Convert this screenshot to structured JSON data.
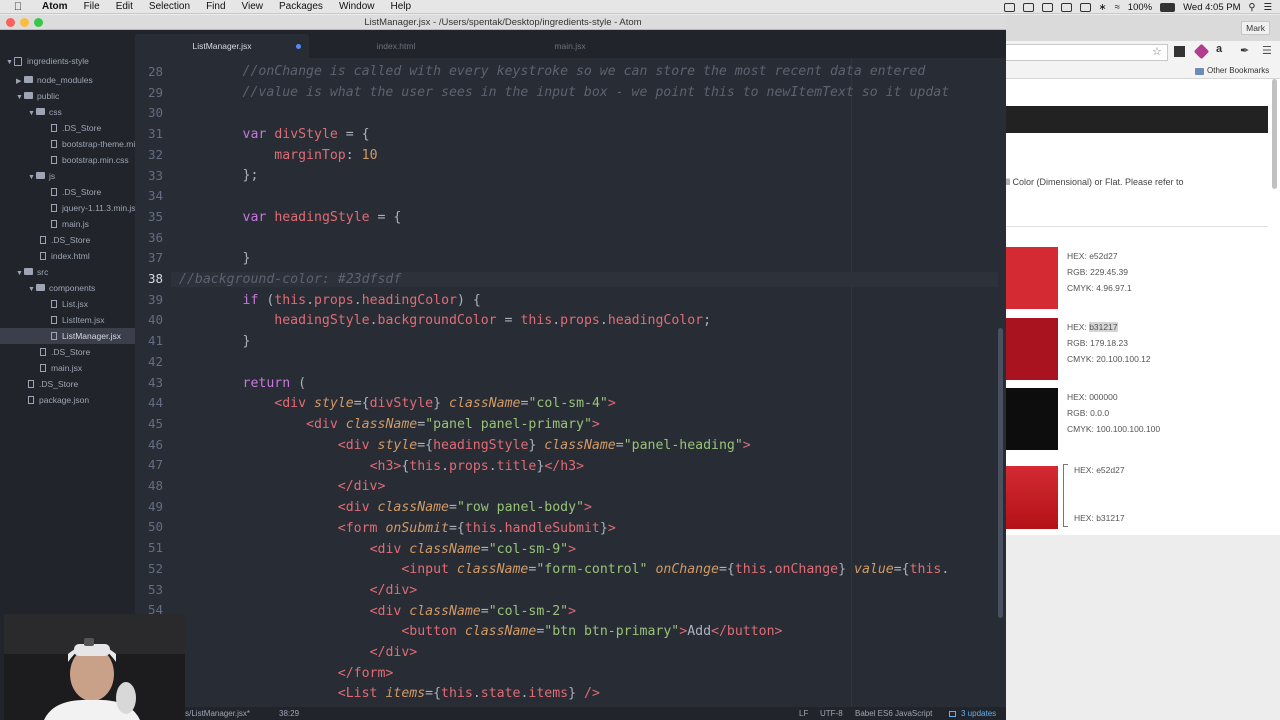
{
  "menubar": {
    "app_name": "Atom",
    "items": [
      "File",
      "Edit",
      "Selection",
      "Find",
      "View",
      "Packages",
      "Window",
      "Help"
    ],
    "battery": "100%",
    "clock": "Wed 4:05 PM"
  },
  "window": {
    "title": "ListManager.jsx - /Users/spentak/Desktop/ingredients-style - Atom"
  },
  "tree": {
    "root": "ingredients-style",
    "items": [
      {
        "label": "node_modules",
        "type": "folder"
      },
      {
        "label": "public",
        "type": "folder"
      },
      {
        "label": "css",
        "type": "folder"
      },
      {
        "label": ".DS_Store",
        "type": "file"
      },
      {
        "label": "bootstrap-theme.min.css",
        "type": "file"
      },
      {
        "label": "bootstrap.min.css",
        "type": "file"
      },
      {
        "label": "js",
        "type": "folder"
      },
      {
        "label": ".DS_Store",
        "type": "file"
      },
      {
        "label": "jquery-1.11.3.min.js",
        "type": "file"
      },
      {
        "label": "main.js",
        "type": "file"
      },
      {
        "label": ".DS_Store",
        "type": "file"
      },
      {
        "label": "index.html",
        "type": "file"
      },
      {
        "label": "src",
        "type": "folder"
      },
      {
        "label": "components",
        "type": "folder"
      },
      {
        "label": "List.jsx",
        "type": "file"
      },
      {
        "label": "ListItem.jsx",
        "type": "file"
      },
      {
        "label": "ListManager.jsx",
        "type": "file"
      },
      {
        "label": ".DS_Store",
        "type": "file"
      },
      {
        "label": "main.jsx",
        "type": "file"
      },
      {
        "label": ".DS_Store",
        "type": "file"
      },
      {
        "label": "package.json",
        "type": "file"
      }
    ]
  },
  "tabs": [
    {
      "label": "ListManager.jsx",
      "active": true,
      "modified": true
    },
    {
      "label": "index.html",
      "active": false
    },
    {
      "label": "main.jsx",
      "active": false
    }
  ],
  "editor": {
    "line_numbers": [
      "28",
      "29",
      "30",
      "31",
      "32",
      "33",
      "34",
      "35",
      "36",
      "37",
      "38",
      "39",
      "40",
      "41",
      "42",
      "43",
      "44",
      "45",
      "46",
      "47",
      "48",
      "49",
      "50",
      "51",
      "52",
      "53",
      "54",
      "55",
      "56",
      "57"
    ],
    "current_line": "38",
    "code": {
      "l28": "        //onChange is called with every keystroke so we can store the most recent data entered",
      "l29": "        //value is what the user sees in the input box - we point this to newItemText so it updat",
      "l38": "//background-color: #23dfsdf"
    }
  },
  "statusbar": {
    "file_path": "ents/ListManager.jsx*",
    "cursor": "38:29",
    "line_ending": "LF",
    "encoding": "UTF-8",
    "grammar": "Babel ES6 JavaScript",
    "updates": "3 updates"
  },
  "browser": {
    "profile": "Mark",
    "bookmarks_label": "Other Bookmarks",
    "intro_text": "ll Color (Dimensional) or Flat. Please refer to",
    "swatches": [
      {
        "color": "#d42a33",
        "hex": "HEX: e52d27",
        "rgb": "RGB: 229.45.39",
        "cmyk": "CMYK: 4.96.97.1"
      },
      {
        "color": "#a9131f",
        "hex_label": "HEX: ",
        "hex_value": "b31217",
        "rgb": "RGB: 179.18.23",
        "cmyk": "CMYK: 20.100.100.12"
      },
      {
        "color": "#0d0d0d",
        "hex": "HEX: 000000",
        "rgb": "RGB: 0.0.0",
        "cmyk": "CMYK: 100.100.100.100"
      }
    ],
    "gradient": {
      "from": "HEX: e52d27",
      "to": "HEX: b31217",
      "color_top": "#d42a33",
      "color_bottom": "#b31217"
    }
  }
}
